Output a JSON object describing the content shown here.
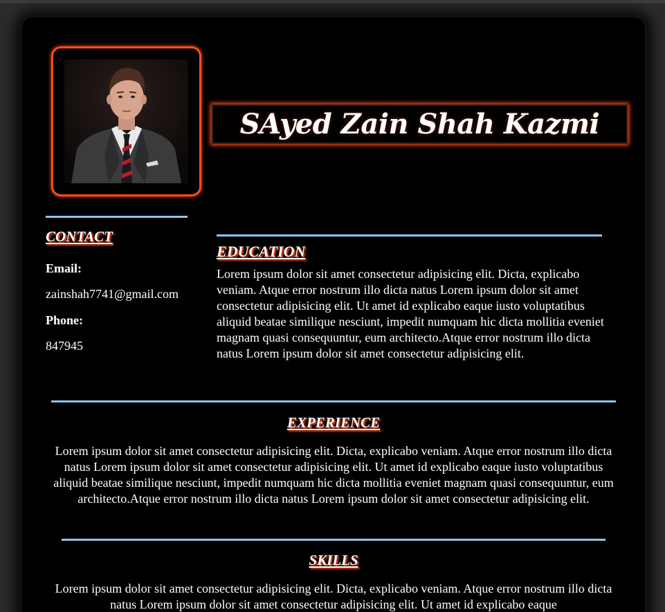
{
  "profile": {
    "name": "SAyed Zain Shah Kazmi",
    "photo_alt": "profile photo"
  },
  "contact": {
    "heading": "CONTACT",
    "email_label": "Email:",
    "email_value": "zainshah7741@gmail.com",
    "phone_label": "Phone:",
    "phone_value": "847945"
  },
  "education": {
    "heading": "EDUCATION",
    "text": "Lorem ipsum dolor sit amet consectetur adipisicing elit. Dicta, explicabo veniam. Atque error nostrum illo dicta natus Lorem ipsum dolor sit amet consectetur adipisicing elit. Ut amet id explicabo eaque iusto voluptatibus aliquid beatae similique nesciunt, impedit numquam hic dicta mollitia eveniet magnam quasi consequuntur, eum architecto.Atque error nostrum illo dicta natus Lorem ipsum dolor sit amet consectetur adipisicing elit."
  },
  "experience": {
    "heading": "EXPERIENCE",
    "text": "Lorem ipsum dolor sit amet consectetur adipisicing elit. Dicta, explicabo veniam. Atque error nostrum illo dicta natus Lorem ipsum dolor sit amet consectetur adipisicing elit. Ut amet id explicabo eaque iusto voluptatibus aliquid beatae similique nesciunt, impedit numquam hic dicta mollitia eveniet magnam quasi consequuntur, eum architecto.Atque error nostrum illo dicta natus Lorem ipsum dolor sit amet consectetur adipisicing elit."
  },
  "skills": {
    "heading": "SKILLS",
    "text": "Lorem ipsum dolor sit amet consectetur adipisicing elit. Dicta, explicabo veniam. Atque error nostrum illo dicta natus Lorem ipsum dolor sit amet consectetur adipisicing elit. Ut amet id explicabo eaque"
  },
  "colors": {
    "accent_orange": "#ff4d1a",
    "divider_blue": "#8ec5ea",
    "background": "#000000"
  }
}
